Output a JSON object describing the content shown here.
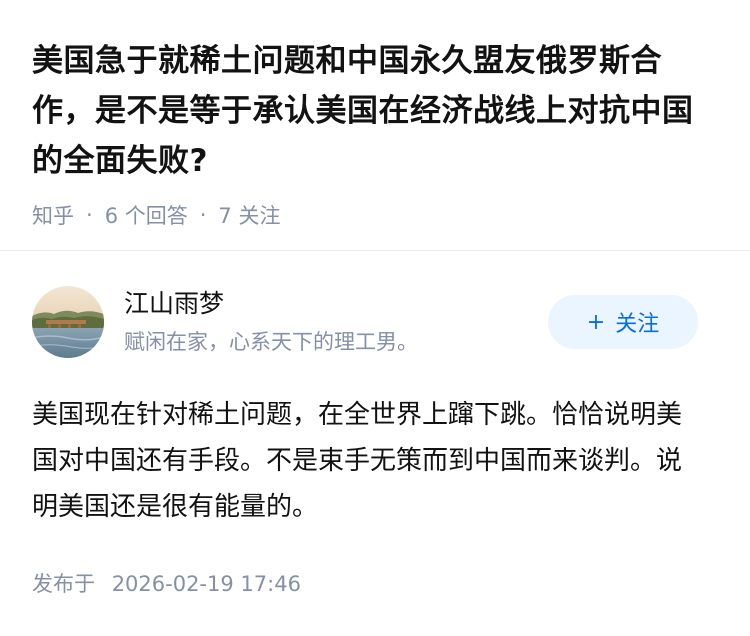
{
  "question": {
    "title": "美国急于就稀土问题和中国永久盟友俄罗斯合作，是不是等于承认美国在经济战线上对抗中国的全面失败?",
    "source": "知乎",
    "answers_count": "6 个回答",
    "followers_count": "7 关注"
  },
  "author": {
    "name": "江山雨梦",
    "bio": "赋闲在家，心系天下的理工男。",
    "follow_plus": "+",
    "follow_label": "关注"
  },
  "answer": {
    "content": "美国现在针对稀土问题，在全世界上蹿下跳。恰恰说明美国对中国还有手段。不是束手无策而到中国而来谈判。说明美国还是很有能量的。",
    "posted_label": "发布于",
    "posted_time": "2026-02-19 17:46"
  },
  "colors": {
    "text_primary": "#121212",
    "text_secondary": "#8590a6",
    "follow_bg": "#ebf5ff",
    "follow_text": "#056de8"
  },
  "icons": {
    "avatar": "landscape-avatar"
  }
}
